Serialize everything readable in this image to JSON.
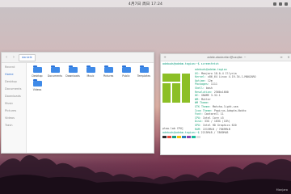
{
  "topbar": {
    "clock": "4月7日 周日 17:24"
  },
  "file_manager": {
    "breadcrumb": "danielk",
    "sidebar": [
      "Recent",
      "Home",
      "Desktop",
      "Documents",
      "Downloads",
      "Music",
      "Pictures",
      "Videos",
      "Trash"
    ],
    "folders": [
      "Desktop",
      "Documents",
      "Downloads",
      "Music",
      "Pictures",
      "Public",
      "Templates",
      "Videos"
    ]
  },
  "terminal": {
    "title": "adebudodanfan@caqite: ~",
    "prompt_top": "adebuds@adebm-tagian:~$ screenfetch",
    "info": [
      {
        "k": "",
        "v": "adebuds@adebm-tagian"
      },
      {
        "k": "OS:",
        "v": "Manjaro 18.0.4 Illyria"
      },
      {
        "k": "Kernel:",
        "v": "x86_64 Linux 4.19.34-1-MANJARO"
      },
      {
        "k": "Uptime:",
        "v": "12m"
      },
      {
        "k": "Packages:",
        "v": "1111"
      },
      {
        "k": "Shell:",
        "v": "bash"
      },
      {
        "k": "Resolution:",
        "v": "2560x1600"
      },
      {
        "k": "DE:",
        "v": "GNOME 3.32.1"
      },
      {
        "k": "WM:",
        "v": "Mutter"
      },
      {
        "k": "WM Theme:",
        "v": ""
      },
      {
        "k": "GTK Theme:",
        "v": "Matcha-light-sea"
      },
      {
        "k": "Icon Theme:",
        "v": "Papirus-Adapta-Nokto"
      },
      {
        "k": "Font:",
        "v": "Cantarell 11"
      },
      {
        "k": "CPU:",
        "v": "Intel Core i5"
      },
      {
        "k": "Disk:",
        "v": "33G / 183G (18%)"
      },
      {
        "k": "GPU:",
        "v": "Intel HD Graphics 620"
      },
      {
        "k": "RAM:",
        "v": "2215MiB / 7869MiB"
      }
    ],
    "middle_line": "ptaw-lab CPU]",
    "bottom_prompt": "adebuds@adebm-tagian:~$",
    "bottom_command": "2215MiB / 7869MiB",
    "palette": [
      "#2b2b2b",
      "#e74c3c",
      "#16a085",
      "#f1c40f",
      "#2980b9",
      "#8e44ad",
      "#1abc9c",
      "#dddddd"
    ]
  },
  "watermark": "Manjaro",
  "colors": {
    "accent": "#2f6fd0",
    "folder": "#3f8ae8",
    "manjaro": "#8cbf26"
  }
}
